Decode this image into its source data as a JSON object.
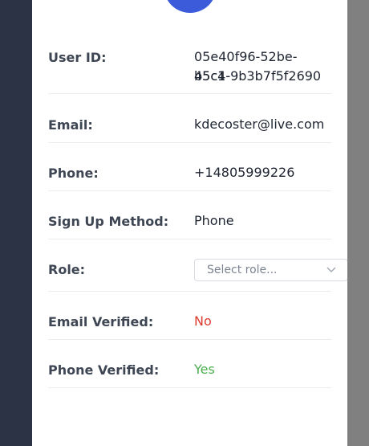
{
  "fields": {
    "user_id": {
      "label": "User ID:",
      "value_line1": "05e40f96-52be-45c1-",
      "value_line2": "b5c4-9b3b7f5f2690"
    },
    "email": {
      "label": "Email:",
      "value": "kdecoster@live.com"
    },
    "phone": {
      "label": "Phone:",
      "value": "+14805999226"
    },
    "signup_method": {
      "label": "Sign Up Method:",
      "value": "Phone"
    },
    "role": {
      "label": "Role:",
      "placeholder": "Select role..."
    },
    "email_verified": {
      "label": "Email Verified:",
      "value": "No"
    },
    "phone_verified": {
      "label": "Phone Verified:",
      "value": "Yes"
    }
  },
  "colors": {
    "avatar": "#3b5bdb",
    "negative": "#dc3b2f",
    "positive": "#4caf50"
  },
  "icons": {
    "avatar": "avatar-icon",
    "role_dropdown": "chevron-down-icon"
  }
}
